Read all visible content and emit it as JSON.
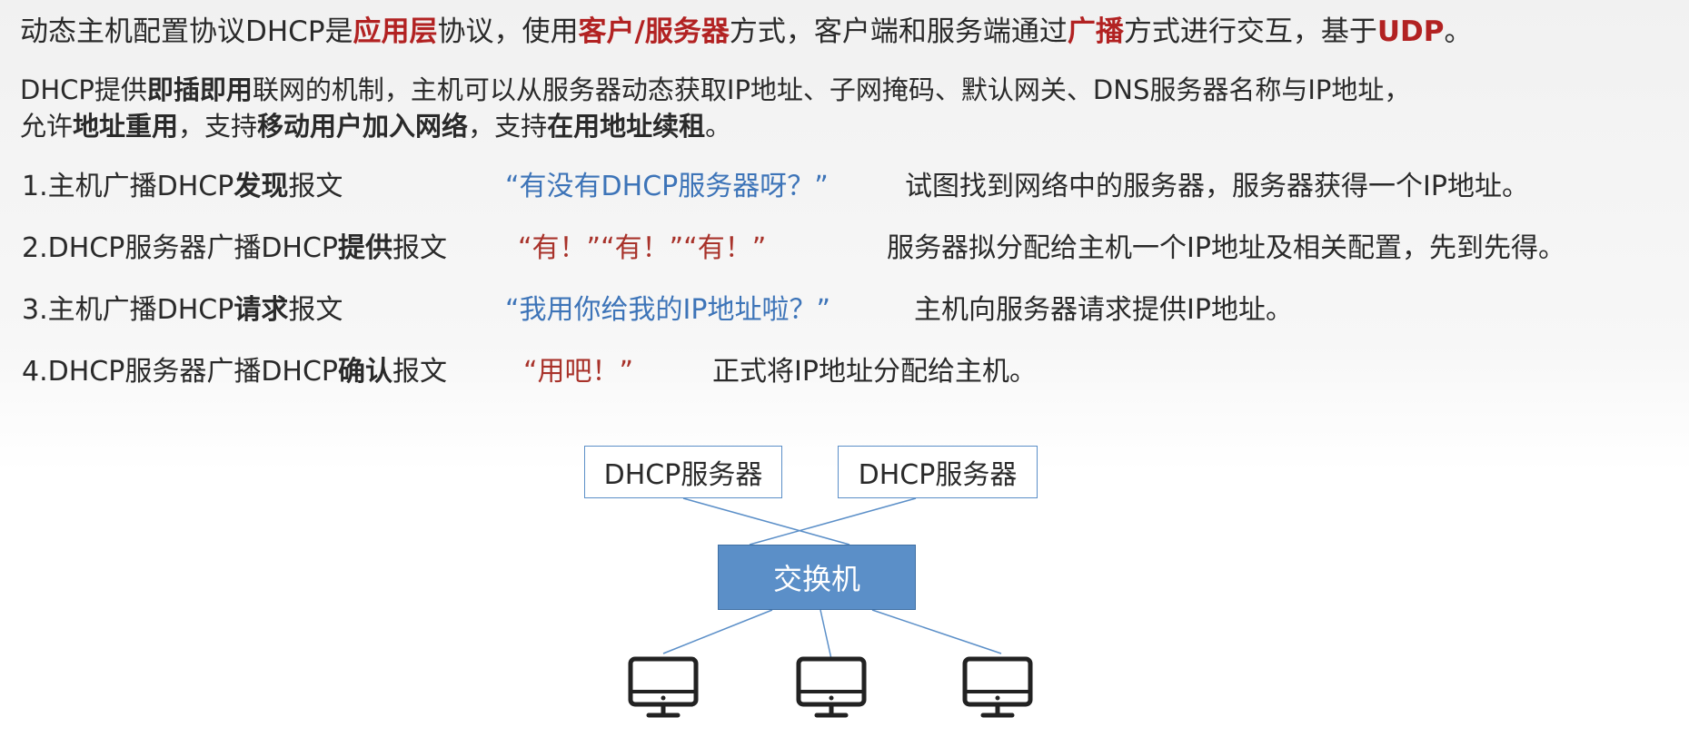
{
  "intro": {
    "p1": {
      "a": "动态主机配置协议DHCP是",
      "b": "应用层",
      "c": "协议，使用",
      "d": "客户/服务器",
      "e": "方式，客户端和服务端通过",
      "f": "广播",
      "g": "方式进行交互，基于",
      "h": "UDP",
      "i": "。"
    },
    "p2": {
      "a": "DHCP提供",
      "b": "即插即用",
      "c": "联网的机制，主机可以从服务器动态获取IP地址、子网掩码、默认网关、DNS服务器名称与IP地址，"
    },
    "p3": {
      "a": "允许",
      "b": "地址重用",
      "c": "，支持",
      "d": "移动用户加入网络",
      "e": "，支持",
      "f": "在用地址续租",
      "g": "。"
    }
  },
  "steps": [
    {
      "pre": "1.主机广播DHCP",
      "bold": "发现",
      "post": "报文",
      "quote": "“有没有DHCP服务器呀？”",
      "desc": "试图找到网络中的服务器，服务器获得一个IP地址。"
    },
    {
      "pre": "2.DHCP服务器广播DHCP",
      "bold": "提供",
      "post": "报文",
      "quote": "“有！”“有！”“有！”",
      "desc": "服务器拟分配给主机一个IP地址及相关配置，先到先得。"
    },
    {
      "pre": "3.主机广播DHCP",
      "bold": "请求",
      "post": "报文",
      "quote": "“我用你给我的IP地址啦？”",
      "desc": "主机向服务器请求提供IP地址。"
    },
    {
      "pre": "4.DHCP服务器广播DHCP",
      "bold": "确认",
      "post": "报文",
      "quote": "“用吧！”",
      "desc": "正式将IP地址分配给主机。"
    }
  ],
  "diagram": {
    "server1": "DHCP服务器",
    "server2": "DHCP服务器",
    "switch": "交换机",
    "line_color": "#5b8fc8",
    "switch_color": "#5b8fc8",
    "hosts_icon": "monitor-icon"
  },
  "colors": {
    "highlight": "#b22222",
    "quote_blue": "#3d74b8",
    "quote_red": "#a8322a"
  }
}
